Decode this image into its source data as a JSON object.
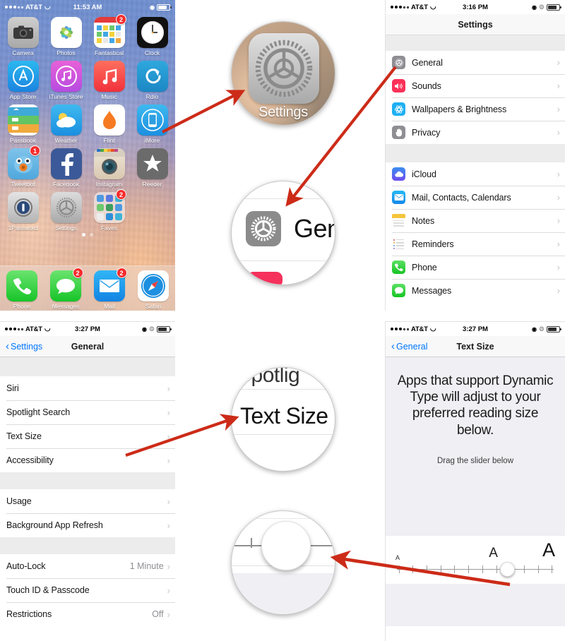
{
  "panels": {
    "home": {
      "name": "iphone-home-screen",
      "statusbar": {
        "carrier": "AT&T",
        "time": "11:53 AM",
        "wifi_icon": "wifi-icon",
        "lock_icon": "rotation-lock-icon",
        "bluetooth_icon": "bluetooth-icon",
        "battery_icon": "battery-icon"
      },
      "rows": [
        [
          {
            "name": "Camera",
            "icon": "camera-icon",
            "badge": ""
          },
          {
            "name": "Photos",
            "icon": "photos-icon",
            "badge": ""
          },
          {
            "name": "Fantastical",
            "icon": "fantastical-icon",
            "badge": "2"
          },
          {
            "name": "Clock",
            "icon": "clock-icon",
            "badge": ""
          }
        ],
        [
          {
            "name": "App Store",
            "icon": "app-store-icon",
            "badge": ""
          },
          {
            "name": "iTunes Store",
            "icon": "itunes-store-icon",
            "badge": ""
          },
          {
            "name": "Music",
            "icon": "music-icon",
            "badge": ""
          },
          {
            "name": "Rdio",
            "icon": "rdio-icon",
            "badge": ""
          }
        ],
        [
          {
            "name": "Passbook",
            "icon": "passbook-icon",
            "badge": ""
          },
          {
            "name": "Weather",
            "icon": "weather-icon",
            "badge": ""
          },
          {
            "name": "Flint",
            "icon": "flint-icon",
            "badge": ""
          },
          {
            "name": "iMore",
            "icon": "imore-icon",
            "badge": ""
          }
        ],
        [
          {
            "name": "Tweetbot",
            "icon": "tweetbot-icon",
            "badge": "1"
          },
          {
            "name": "Facebook",
            "icon": "facebook-icon",
            "badge": ""
          },
          {
            "name": "Instagram",
            "icon": "instagram-icon",
            "badge": ""
          },
          {
            "name": "Reeder",
            "icon": "reeder-icon",
            "badge": ""
          }
        ],
        [
          {
            "name": "1Password",
            "icon": "1password-icon",
            "badge": ""
          },
          {
            "name": "Settings",
            "icon": "settings-gear-icon",
            "badge": ""
          },
          {
            "name": "Faves",
            "icon": "faves-folder-icon",
            "badge": "2"
          }
        ]
      ],
      "dock": [
        {
          "name": "Phone",
          "icon": "phone-icon",
          "badge": ""
        },
        {
          "name": "Messages",
          "icon": "messages-icon",
          "badge": "2"
        },
        {
          "name": "Mail",
          "icon": "mail-icon",
          "badge": "2"
        },
        {
          "name": "Safari",
          "icon": "safari-icon",
          "badge": ""
        }
      ],
      "page_dots": 2,
      "active_page": 0
    },
    "settings": {
      "statusbar": {
        "carrier": "AT&T",
        "time": "3:16 PM"
      },
      "title": "Settings",
      "groups": [
        [
          {
            "label": "General",
            "icon": "settings-gear-icon",
            "value": ""
          },
          {
            "label": "Sounds",
            "icon": "sounds-speaker-icon",
            "value": ""
          },
          {
            "label": "Wallpapers & Brightness",
            "icon": "wallpapers-icon",
            "value": ""
          },
          {
            "label": "Privacy",
            "icon": "privacy-hand-icon",
            "value": ""
          }
        ],
        [
          {
            "label": "iCloud",
            "icon": "icloud-icon",
            "value": ""
          },
          {
            "label": "Mail, Contacts, Calendars",
            "icon": "mail-icon",
            "value": ""
          },
          {
            "label": "Notes",
            "icon": "notes-icon",
            "value": ""
          },
          {
            "label": "Reminders",
            "icon": "reminders-icon",
            "value": ""
          },
          {
            "label": "Phone",
            "icon": "phone-icon",
            "value": ""
          },
          {
            "label": "Messages",
            "icon": "messages-icon",
            "value": ""
          }
        ]
      ]
    },
    "general": {
      "statusbar": {
        "carrier": "AT&T",
        "time": "3:27 PM"
      },
      "back_label": "Settings",
      "title": "General",
      "groups": [
        [
          {
            "label": "Siri",
            "value": ""
          },
          {
            "label": "Spotlight Search",
            "value": ""
          },
          {
            "label": "Text Size",
            "value": ""
          },
          {
            "label": "Accessibility",
            "value": ""
          }
        ],
        [
          {
            "label": "Usage",
            "value": ""
          },
          {
            "label": "Background App Refresh",
            "value": ""
          }
        ],
        [
          {
            "label": "Auto-Lock",
            "value": "1 Minute"
          },
          {
            "label": "Touch ID & Passcode",
            "value": ""
          },
          {
            "label": "Restrictions",
            "value": "Off"
          }
        ]
      ]
    },
    "textsize": {
      "statusbar": {
        "carrier": "AT&T",
        "time": "3:27 PM"
      },
      "back_label": "General",
      "title": "Text Size",
      "description": "Apps that support Dynamic Type will adjust to your preferred reading size below.",
      "hint": "Drag the slider below",
      "slider": {
        "small_letter": "A",
        "medium_letter": "A",
        "large_letter": "A",
        "ticks": 12,
        "value_percent": 70
      }
    }
  },
  "magnifiers": [
    {
      "name": "magnifier-settings-app-icon",
      "caption": "Settings"
    },
    {
      "name": "magnifier-general-row",
      "caption": "Gen"
    },
    {
      "name": "magnifier-text-size-row",
      "caption": "Text Size"
    },
    {
      "name": "magnifier-text-size-slider",
      "caption": ""
    }
  ],
  "annotations": {
    "arrow_color": "#cc2b18",
    "arrows": [
      {
        "name": "arrow-to-settings-app-icon"
      },
      {
        "name": "arrow-to-general-row"
      },
      {
        "name": "arrow-to-text-size-row"
      },
      {
        "name": "arrow-to-slider-thumb"
      }
    ]
  }
}
